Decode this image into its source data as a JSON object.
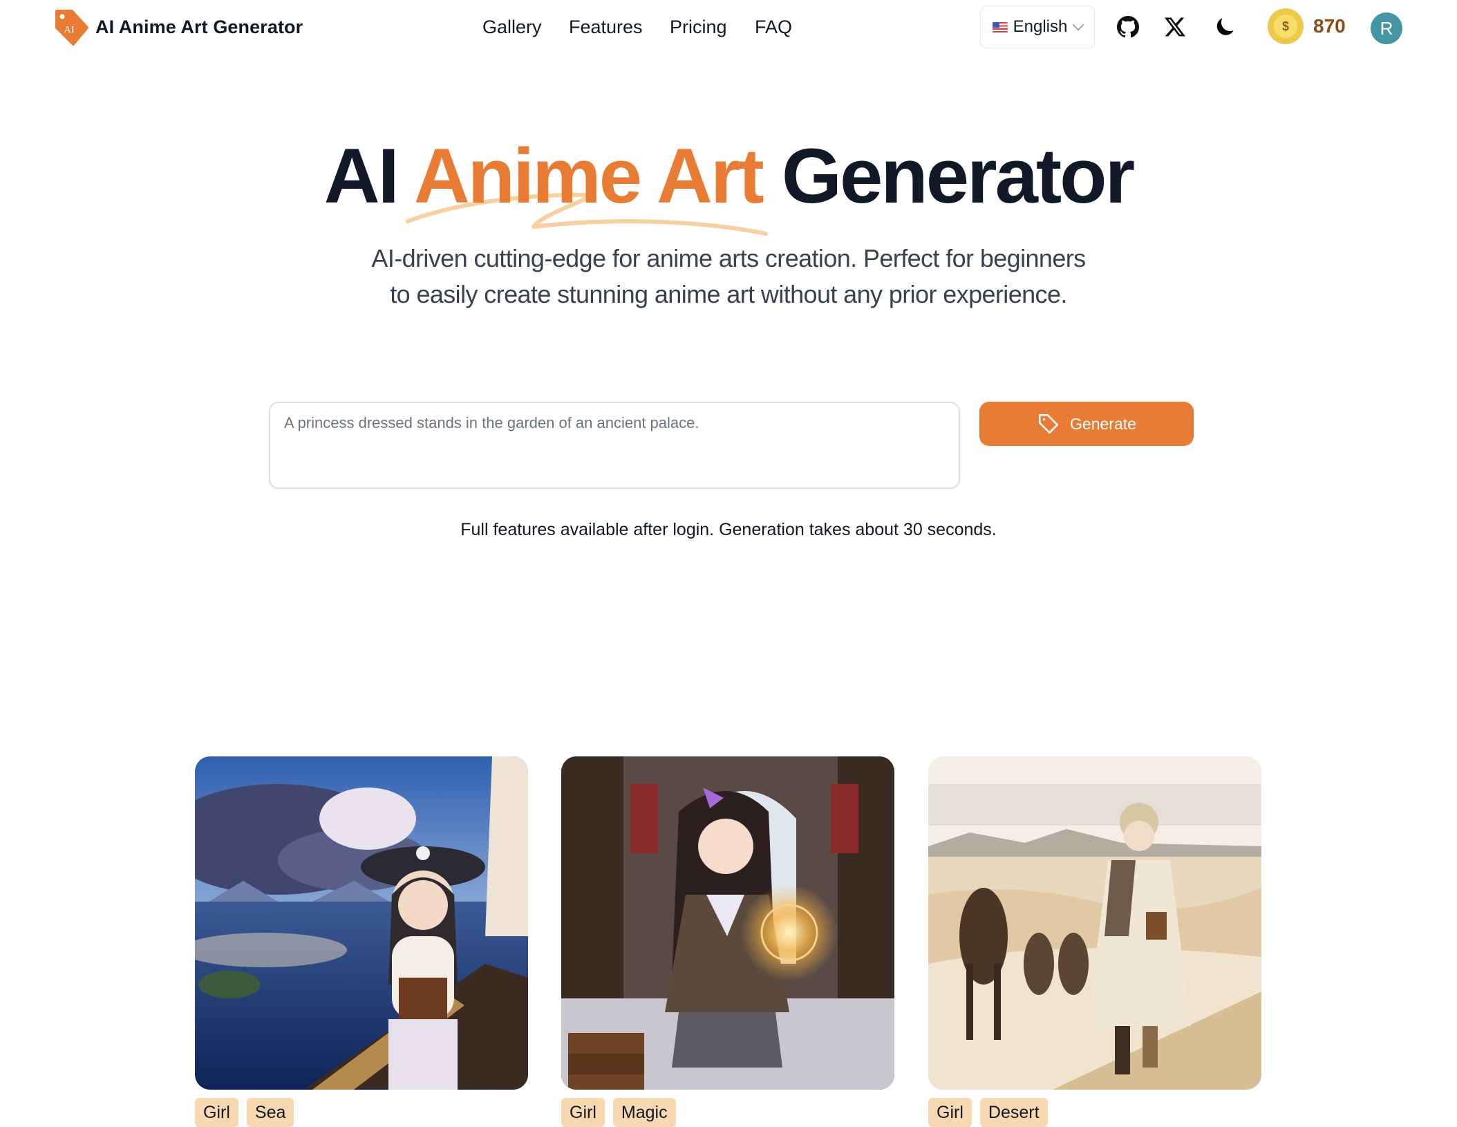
{
  "header": {
    "brand": "AI Anime Art Generator",
    "logo_text": "AI",
    "nav": [
      {
        "label": "Gallery"
      },
      {
        "label": "Features"
      },
      {
        "label": "Pricing"
      },
      {
        "label": "FAQ"
      }
    ],
    "language": {
      "selected": "English",
      "flag": "us-flag-icon"
    },
    "icons": [
      "github-icon",
      "x-icon",
      "moon-icon"
    ],
    "credits": "870",
    "coin_symbol": "$",
    "avatar_initial": "R"
  },
  "hero": {
    "title_part1": "AI ",
    "title_accent": "Anime Art",
    "title_part2": " Generator",
    "subtitle_line1": "AI-driven cutting-edge for anime arts creation. Perfect for beginners",
    "subtitle_line2": "to easily create stunning anime art without any prior experience."
  },
  "prompt": {
    "placeholder": "A princess dressed stands in the garden of an ancient palace.",
    "value": "",
    "generate_label": "Generate"
  },
  "note": "Full features available after login. Generation takes about 30 seconds.",
  "gallery": [
    {
      "subject": "Pirate girl on a ship at sea",
      "tags": [
        "Girl",
        "Sea"
      ]
    },
    {
      "subject": "Girl casting magic in a library",
      "tags": [
        "Girl",
        "Magic"
      ]
    },
    {
      "subject": "Girl walking with camels in desert",
      "tags": [
        "Girl",
        "Desert"
      ]
    }
  ],
  "colors": {
    "accent": "#e97c35",
    "swash": "#f7cfa0",
    "tag_bg": "#f8d8b0",
    "avatar": "#4596a4",
    "credits_text": "#8b4c17"
  }
}
